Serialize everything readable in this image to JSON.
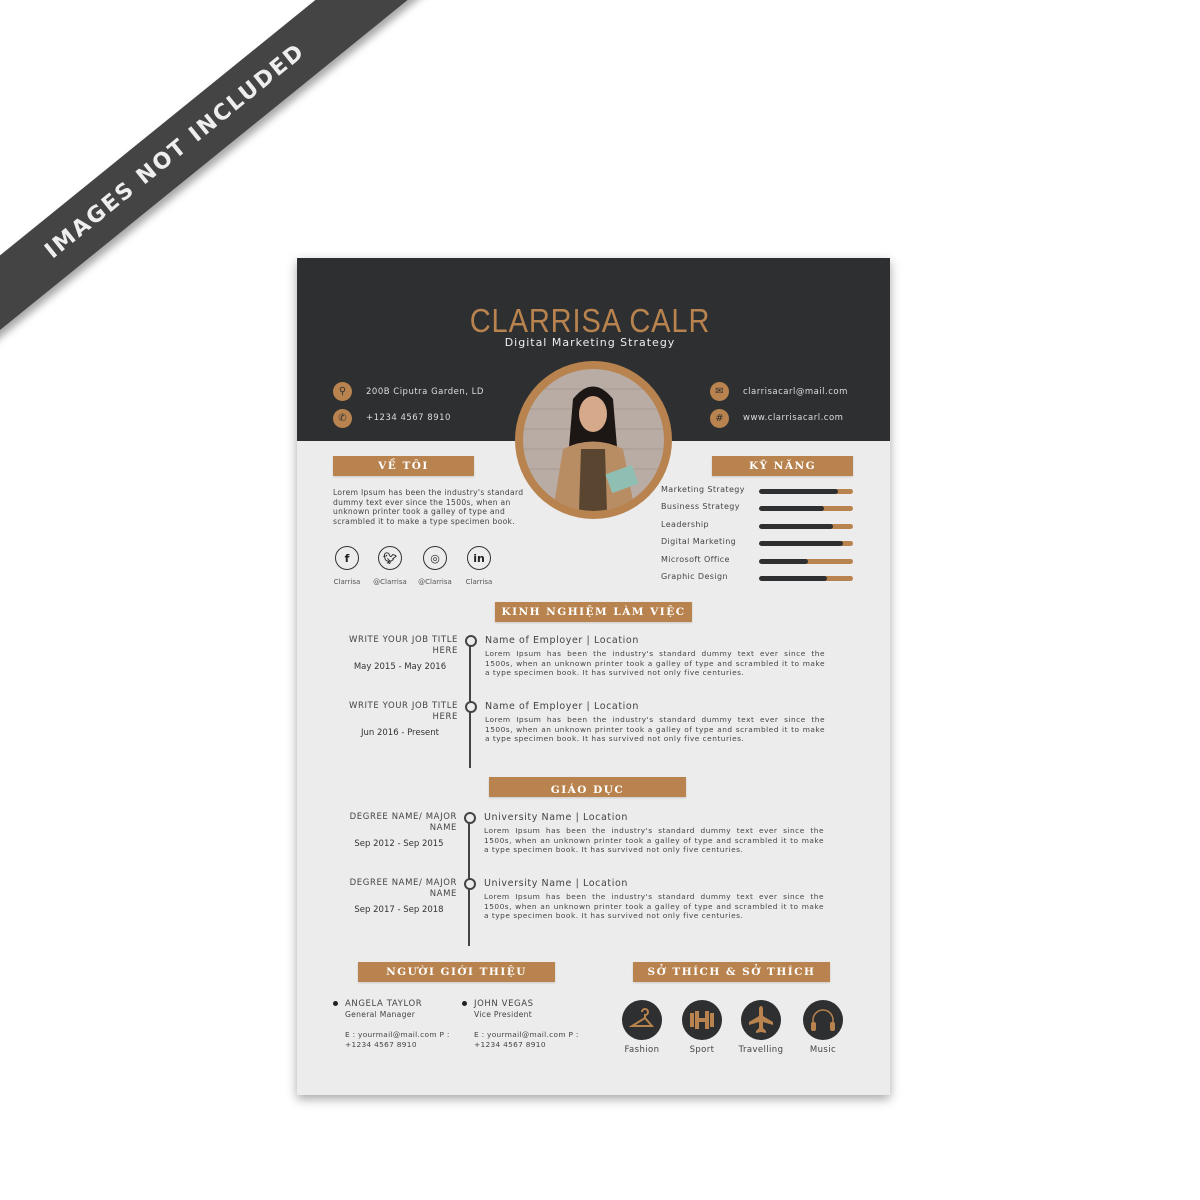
{
  "watermark": "IMAGES NOT INCLUDED",
  "colors": {
    "accent": "#b8834e",
    "dark": "#2e2f31",
    "paper": "#ececec"
  },
  "header": {
    "name": "CLARRISA CALR",
    "role": "Digital Marketing Strategy",
    "contacts": [
      {
        "icon": "location-pin-icon",
        "text": "200B Ciputra Garden, LD"
      },
      {
        "icon": "phone-icon",
        "text": "+1234 4567 8910"
      },
      {
        "icon": "mail-icon",
        "text": "clarrisacarl@mail.com"
      },
      {
        "icon": "web-icon",
        "text": "www.clarrisacarl.com"
      }
    ]
  },
  "about": {
    "title": "VỀ TÔI",
    "text": "Lorem Ipsum has been the industry's standard dummy text ever since the 1500s, when an unknown printer took a galley of type and scrambled it to make a type specimen book.",
    "social": [
      {
        "icon": "facebook-icon",
        "label": "Clarrisa"
      },
      {
        "icon": "twitter-icon",
        "label": "@Clarrisa"
      },
      {
        "icon": "instagram-icon",
        "label": "@Clarrisa"
      },
      {
        "icon": "linkedin-icon",
        "label": "Clarrisa"
      }
    ]
  },
  "skills": {
    "title": "KỸ NĂNG",
    "items": [
      {
        "label": "Marketing Strategy",
        "level": 0.84
      },
      {
        "label": "Business Strategy",
        "level": 0.69
      },
      {
        "label": "Leadership",
        "level": 0.79
      },
      {
        "label": "Digital Marketing",
        "level": 0.89
      },
      {
        "label": "Microsoft Office",
        "level": 0.52
      },
      {
        "label": "Graphic Design",
        "level": 0.72
      }
    ]
  },
  "experience": {
    "title": "KINH NGHIỆM LÀM VIỆC",
    "items": [
      {
        "left": "WRITE YOUR JOB TITLE HERE",
        "date": "May 2015 - May 2016",
        "heading": "Name of Employer | Location",
        "text": "Lorem Ipsum has been the industry's standard dummy text ever since the 1500s, when an unknown printer took a galley of type and scrambled it to make a type specimen book. It has survived not only five centuries."
      },
      {
        "left": "WRITE YOUR JOB TITLE HERE",
        "date": "Jun 2016 - Present",
        "heading": "Name of Employer | Location",
        "text": "Lorem Ipsum has been the industry's standard dummy text ever since the 1500s, when an unknown printer took a galley of type and scrambled it to make a type specimen book. It has survived not only five centuries."
      }
    ]
  },
  "education": {
    "title": "GIÁO DỤC",
    "items": [
      {
        "left": "DEGREE NAME/ MAJOR NAME",
        "date": "Sep 2012 - Sep 2015",
        "heading": "University Name | Location",
        "text": "Lorem Ipsum has been the industry's standard dummy text ever since the 1500s, when an unknown printer took a galley of type and scrambled it to make a type specimen book. It has survived not only five centuries."
      },
      {
        "left": "DEGREE NAME/ MAJOR NAME",
        "date": "Sep 2017 - Sep 2018",
        "heading": "University Name | Location",
        "text": "Lorem Ipsum has been the industry's standard dummy text ever since the 1500s, when an unknown printer took a galley of type and scrambled it to make a type specimen book. It has survived not only five centuries."
      }
    ]
  },
  "references": {
    "title": "NGƯỜI GIỚI THIỆU",
    "items": [
      {
        "name": "ANGELA TAYLOR",
        "role": "General Manager",
        "contact": "E : yourmail@mail.com  P : +1234 4567 8910"
      },
      {
        "name": "JOHN VEGAS",
        "role": "Vice President",
        "contact": "E : yourmail@mail.com  P : +1234 4567 8910"
      }
    ]
  },
  "hobbies": {
    "title": "SỞ THÍCH & SỞ THÍCH",
    "items": [
      {
        "icon": "hanger-icon",
        "label": "Fashion"
      },
      {
        "icon": "dumbbell-icon",
        "label": "Sport"
      },
      {
        "icon": "airplane-icon",
        "label": "Travelling"
      },
      {
        "icon": "headphones-icon",
        "label": "Music"
      }
    ]
  }
}
